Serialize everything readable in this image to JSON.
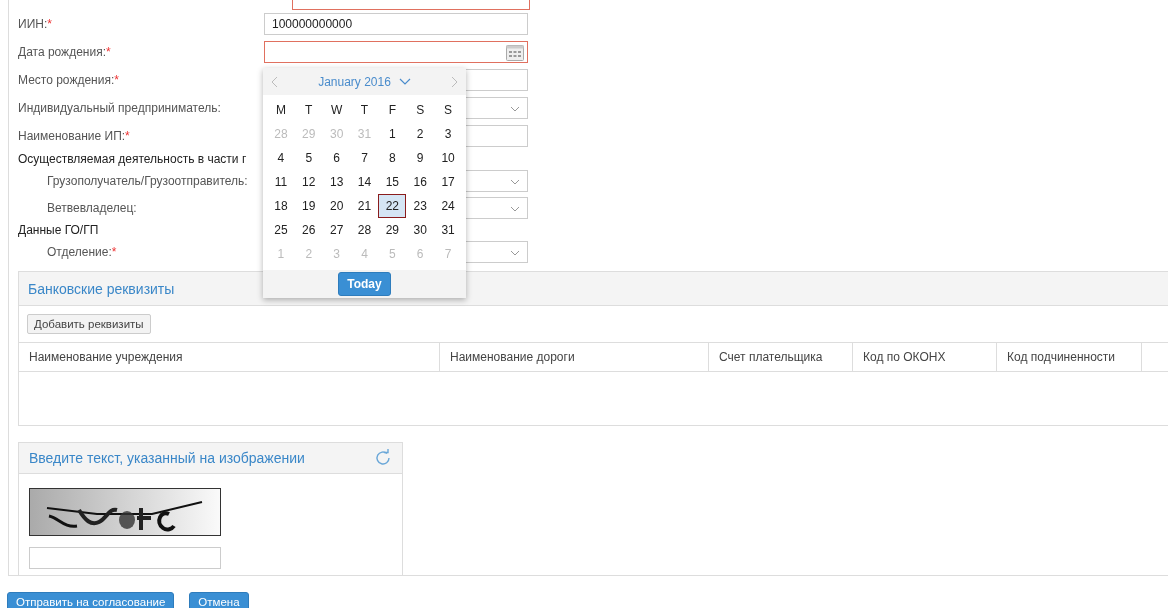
{
  "form": {
    "fields": [
      {
        "kind": "text",
        "error": true
      },
      {
        "kind": "text",
        "label": "ИИН:",
        "required_mark": "*",
        "value": "100000000000",
        "error": false
      },
      {
        "kind": "date",
        "label": "Дата рождения:",
        "required_mark": "*",
        "error": true
      },
      {
        "kind": "text",
        "label": "Место рождения:",
        "required_mark": "*",
        "error": false
      },
      {
        "kind": "select",
        "label": "Индивидуальный предприниматель:",
        "error": false
      },
      {
        "kind": "text",
        "label": "Наименование ИП:",
        "required_mark": "*",
        "error": false
      },
      {
        "kind": "section",
        "label": "Осуществляемая деятельность в части г",
        "children": [
          {
            "kind": "select",
            "label": "Грузополучатель/Грузоотправитель:",
            "error": false
          },
          {
            "kind": "select",
            "label": "Ветвевладелец:",
            "error": false
          }
        ]
      },
      {
        "kind": "section",
        "label": "Данные ГО/ГП",
        "children": [
          {
            "kind": "select",
            "label": "Отделение:",
            "required_mark": "*",
            "error": false
          }
        ]
      }
    ]
  },
  "date_picker": {
    "month_label": "January 2016",
    "weekdays": [
      "M",
      "T",
      "W",
      "T",
      "F",
      "S",
      "S"
    ],
    "days": [
      {
        "label": "28",
        "muted": true,
        "selected": false
      },
      {
        "label": "29",
        "muted": true,
        "selected": false
      },
      {
        "label": "30",
        "muted": true,
        "selected": false
      },
      {
        "label": "31",
        "muted": true,
        "selected": false
      },
      {
        "label": "1",
        "muted": false,
        "selected": false
      },
      {
        "label": "2",
        "muted": false,
        "selected": false
      },
      {
        "label": "3",
        "muted": false,
        "selected": false
      },
      {
        "label": "4",
        "muted": false,
        "selected": false
      },
      {
        "label": "5",
        "muted": false,
        "selected": false
      },
      {
        "label": "6",
        "muted": false,
        "selected": false
      },
      {
        "label": "7",
        "muted": false,
        "selected": false
      },
      {
        "label": "8",
        "muted": false,
        "selected": false
      },
      {
        "label": "9",
        "muted": false,
        "selected": false
      },
      {
        "label": "10",
        "muted": false,
        "selected": false
      },
      {
        "label": "11",
        "muted": false,
        "selected": false
      },
      {
        "label": "12",
        "muted": false,
        "selected": false
      },
      {
        "label": "13",
        "muted": false,
        "selected": false
      },
      {
        "label": "14",
        "muted": false,
        "selected": false
      },
      {
        "label": "15",
        "muted": false,
        "selected": false
      },
      {
        "label": "16",
        "muted": false,
        "selected": false
      },
      {
        "label": "17",
        "muted": false,
        "selected": false
      },
      {
        "label": "18",
        "muted": false,
        "selected": false
      },
      {
        "label": "19",
        "muted": false,
        "selected": false
      },
      {
        "label": "20",
        "muted": false,
        "selected": false
      },
      {
        "label": "21",
        "muted": false,
        "selected": false
      },
      {
        "label": "22",
        "muted": false,
        "selected": true
      },
      {
        "label": "23",
        "muted": false,
        "selected": false
      },
      {
        "label": "24",
        "muted": false,
        "selected": false
      },
      {
        "label": "25",
        "muted": false,
        "selected": false
      },
      {
        "label": "26",
        "muted": false,
        "selected": false
      },
      {
        "label": "27",
        "muted": false,
        "selected": false
      },
      {
        "label": "28",
        "muted": false,
        "selected": false
      },
      {
        "label": "29",
        "muted": false,
        "selected": false
      },
      {
        "label": "30",
        "muted": false,
        "selected": false
      },
      {
        "label": "31",
        "muted": false,
        "selected": false
      },
      {
        "label": "1",
        "muted": true,
        "selected": false
      },
      {
        "label": "2",
        "muted": true,
        "selected": false
      },
      {
        "label": "3",
        "muted": true,
        "selected": false
      },
      {
        "label": "4",
        "muted": true,
        "selected": false
      },
      {
        "label": "5",
        "muted": true,
        "selected": false
      },
      {
        "label": "6",
        "muted": true,
        "selected": false
      },
      {
        "label": "7",
        "muted": true,
        "selected": false
      }
    ],
    "today_button": "Today"
  },
  "bank_details": {
    "title": "Банковские реквизиты",
    "add_button": "Добавить реквизиты",
    "table": {
      "columns": [
        "Наименование учреждения",
        "Наименование дороги",
        "Счет плательщика",
        "Код по ОКОНХ",
        "Код подчиненности"
      ]
    }
  },
  "captcha": {
    "title": "Введите текст, указанный на изображении"
  },
  "buttons": [
    "Отправить на согласование",
    "Отмена"
  ]
}
